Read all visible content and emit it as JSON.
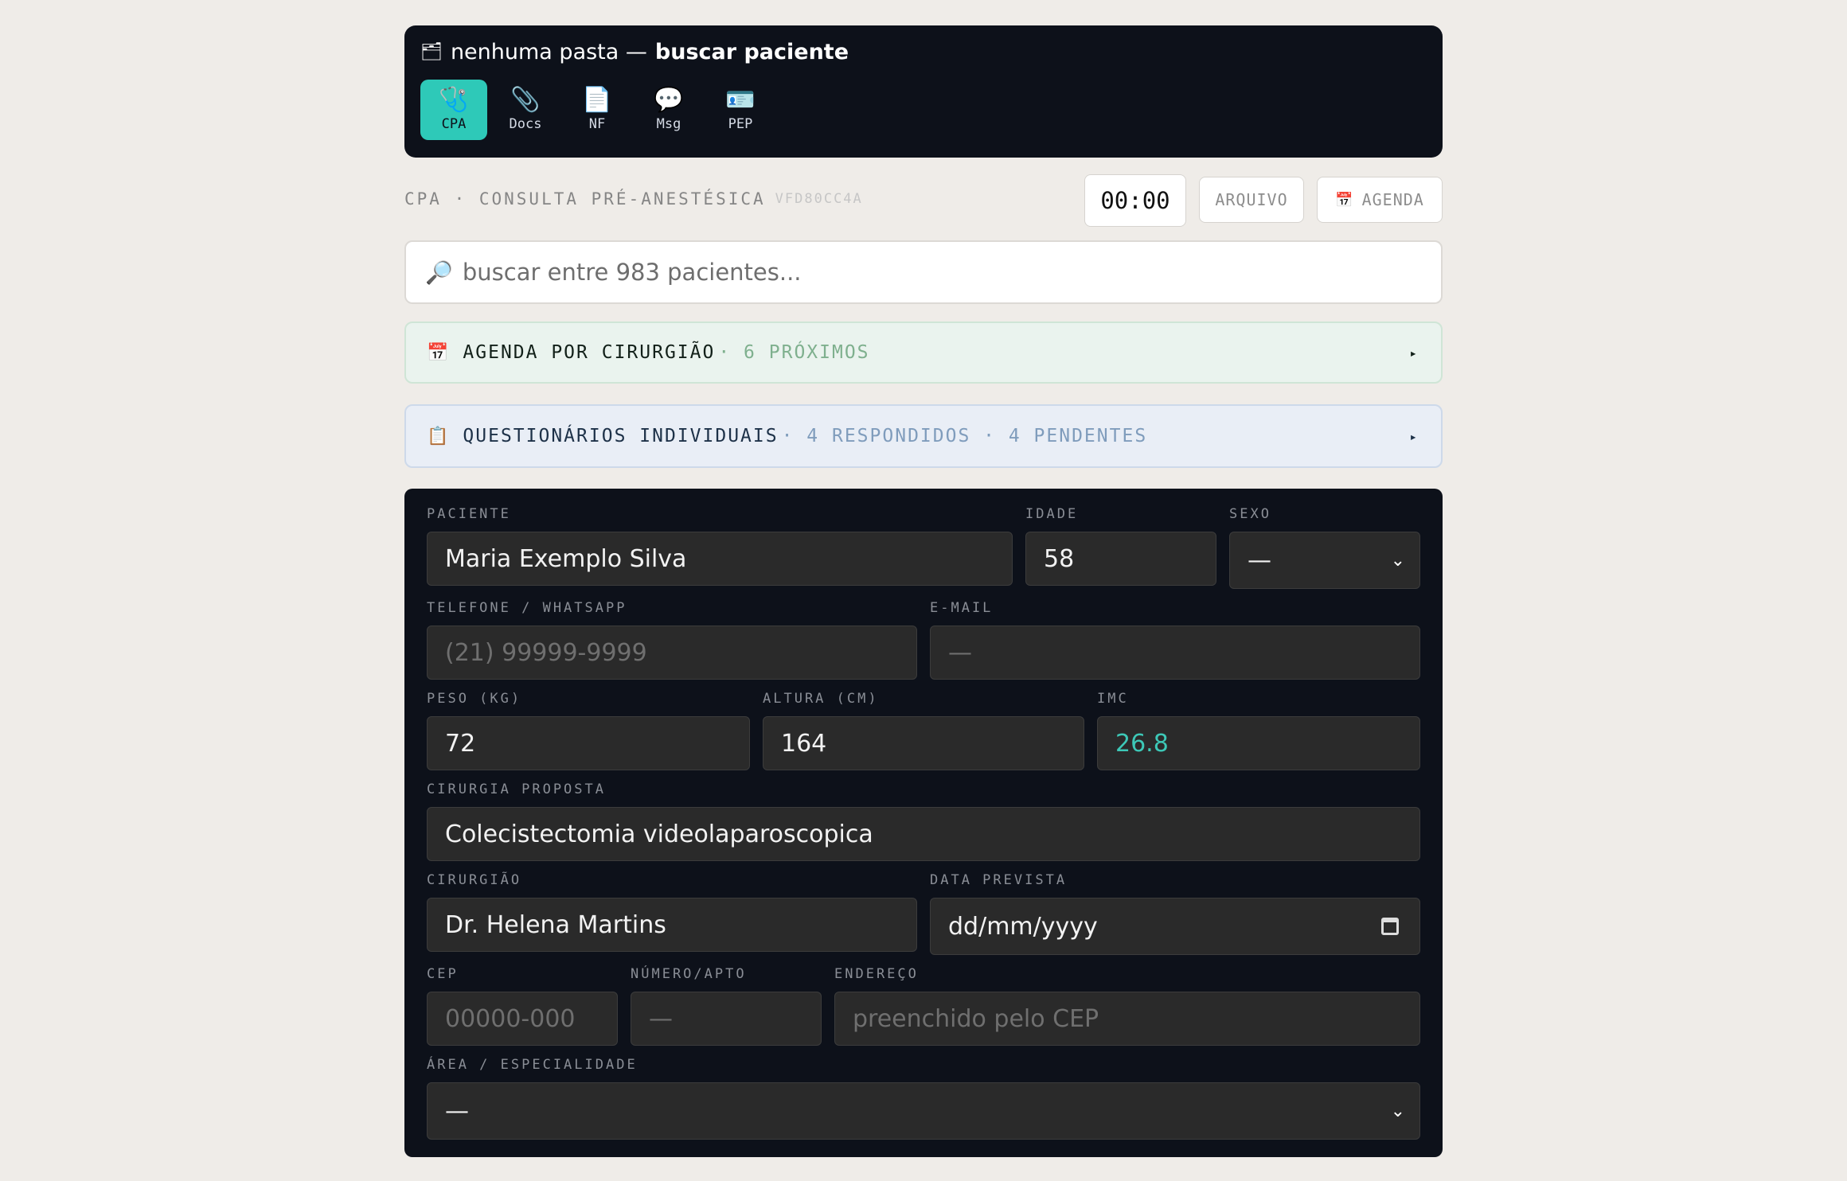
{
  "header": {
    "folder_icon": "folder-icon",
    "folder_text": "nenhuma pasta —",
    "title": "buscar paciente"
  },
  "apps": [
    {
      "label": "CPA",
      "icon": "🩺",
      "icon_name": "stethoscope-icon",
      "active": true
    },
    {
      "label": "Docs",
      "icon": "📎",
      "icon_name": "paperclip-icon",
      "active": false
    },
    {
      "label": "NF",
      "icon": "📄",
      "icon_name": "document-icon",
      "active": false
    },
    {
      "label": "Msg",
      "icon": "💬",
      "icon_name": "chat-bubble-icon",
      "active": false
    },
    {
      "label": "PEP",
      "icon": "🪪",
      "icon_name": "id-card-icon",
      "active": false
    }
  ],
  "module": {
    "label": "CPA · CONSULTA PRÉ-ANESTÉSICA",
    "id": "VFD80CC4A",
    "timer": "00:00",
    "arquivo_label": "ARQUIVO",
    "agenda_label": "AGENDA",
    "agenda_icon": "📅"
  },
  "search": {
    "icon": "🔎",
    "placeholder": "buscar entre 983 pacientes..."
  },
  "agenda_panel": {
    "icon": "📅",
    "title": "AGENDA POR CIRURGIÃO",
    "sub": "· 6 PRÓXIMOS",
    "arrow": "▸"
  },
  "quest_panel": {
    "icon": "📋",
    "title": "QUESTIONÁRIOS INDIVIDUAIS",
    "sub": "· 4 RESPONDIDOS · 4 PENDENTES",
    "arrow": "▸"
  },
  "form": {
    "paciente": {
      "label": "PACIENTE",
      "value": "Maria Exemplo Silva"
    },
    "idade": {
      "label": "IDADE",
      "value": "58"
    },
    "sexo": {
      "label": "SEXO",
      "value": "—"
    },
    "telefone": {
      "label": "TELEFONE / WHATSAPP",
      "placeholder": "(21) 99999-9999"
    },
    "email": {
      "label": "E-MAIL",
      "placeholder": "—"
    },
    "peso": {
      "label": "PESO (KG)",
      "value": "72"
    },
    "altura": {
      "label": "ALTURA (CM)",
      "value": "164"
    },
    "imc": {
      "label": "IMC",
      "value": "26.8"
    },
    "cirurgia": {
      "label": "CIRURGIA PROPOSTA",
      "value": "Colecistectomia videolaparoscopica"
    },
    "cirurgiao": {
      "label": "CIRURGIÃO",
      "value": "Dr. Helena Martins"
    },
    "data": {
      "label": "DATA PREVISTA",
      "placeholder": "dd/mm/yyyy"
    },
    "cep": {
      "label": "CEP",
      "placeholder": "00000-000"
    },
    "numero": {
      "label": "NÚMERO/APTO",
      "placeholder": "—"
    },
    "endereco": {
      "label": "ENDEREÇO",
      "placeholder": "preenchido pelo CEP"
    },
    "area": {
      "label": "ÁREA / ESPECIALIDADE",
      "value": "—"
    }
  }
}
